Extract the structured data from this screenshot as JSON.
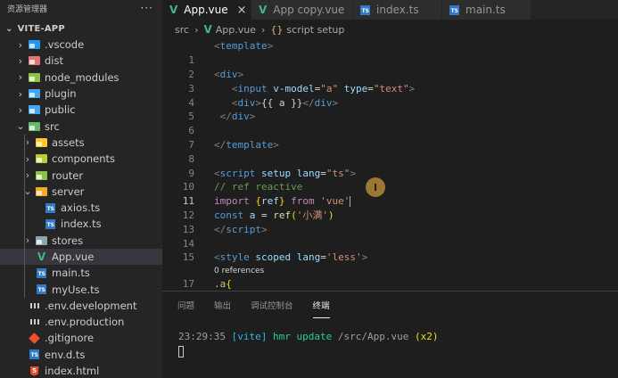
{
  "sidebar": {
    "title": "资源管理器",
    "more": "···",
    "root": "VITE-APP",
    "items": [
      {
        "label": ".vscode",
        "chev": "›",
        "icon": "folder",
        "color": "#2196f3",
        "depth": 0
      },
      {
        "label": "dist",
        "chev": "›",
        "icon": "folder",
        "color": "#e57373",
        "depth": 0
      },
      {
        "label": "node_modules",
        "chev": "›",
        "icon": "folder",
        "color": "#8bc34a",
        "depth": 0
      },
      {
        "label": "plugin",
        "chev": "›",
        "icon": "folder",
        "color": "#42a5f5",
        "depth": 0
      },
      {
        "label": "public",
        "chev": "›",
        "icon": "folder",
        "color": "#42a5f5",
        "depth": 0
      },
      {
        "label": "src",
        "chev": "⌄",
        "icon": "folder",
        "color": "#66bb6a",
        "depth": 0
      },
      {
        "label": "assets",
        "chev": "›",
        "icon": "folder",
        "color": "#ffca28",
        "depth": 1
      },
      {
        "label": "components",
        "chev": "›",
        "icon": "folder",
        "color": "#c0ca33",
        "depth": 1
      },
      {
        "label": "router",
        "chev": "›",
        "icon": "folder",
        "color": "#8bc34a",
        "depth": 1
      },
      {
        "label": "server",
        "chev": "⌄",
        "icon": "folder",
        "color": "#ffa726",
        "depth": 1
      },
      {
        "label": "axios.ts",
        "chev": "",
        "icon": "ts",
        "depth": 2
      },
      {
        "label": "index.ts",
        "chev": "",
        "icon": "ts",
        "depth": 2
      },
      {
        "label": "stores",
        "chev": "›",
        "icon": "folder",
        "color": "#90a4ae",
        "depth": 1
      },
      {
        "label": "App.vue",
        "chev": "",
        "icon": "vue",
        "depth": 1,
        "selected": true
      },
      {
        "label": "main.ts",
        "chev": "",
        "icon": "ts",
        "depth": 1
      },
      {
        "label": "myUse.ts",
        "chev": "",
        "icon": "ts",
        "depth": 1
      },
      {
        "label": ".env.development",
        "chev": "",
        "icon": "env",
        "depth": 0
      },
      {
        "label": ".env.production",
        "chev": "",
        "icon": "env",
        "depth": 0
      },
      {
        "label": ".gitignore",
        "chev": "",
        "icon": "git",
        "depth": 0
      },
      {
        "label": "env.d.ts",
        "chev": "",
        "icon": "ts",
        "depth": 0
      },
      {
        "label": "index.html",
        "chev": "",
        "icon": "html",
        "depth": 0
      }
    ]
  },
  "tabs": [
    {
      "label": "App.vue",
      "icon": "vue",
      "active": true,
      "close": "×"
    },
    {
      "label": "App copy.vue",
      "icon": "vue",
      "active": false
    },
    {
      "label": "index.ts",
      "icon": "ts",
      "active": false
    },
    {
      "label": "main.ts",
      "icon": "ts",
      "active": false
    }
  ],
  "breadcrumb": {
    "src": "src",
    "sep": "›",
    "file": "App.vue",
    "braces": "{}",
    "symbol": "script setup"
  },
  "code": [
    {
      "n": "",
      "kind": "code",
      "tokens": [
        [
          "<",
          "t-punc"
        ],
        [
          "template",
          "t-tag"
        ],
        [
          ">",
          "t-punc"
        ]
      ]
    },
    {
      "n": "1",
      "kind": "code",
      "tokens": []
    },
    {
      "n": "2",
      "kind": "code",
      "tokens": [
        [
          "<",
          "t-punc"
        ],
        [
          "div",
          "t-tag"
        ],
        [
          ">",
          "t-punc"
        ]
      ]
    },
    {
      "n": "3",
      "kind": "code",
      "tokens": [
        [
          "   ",
          "t-plain"
        ],
        [
          "<",
          "t-punc"
        ],
        [
          "input",
          "t-tag"
        ],
        [
          " ",
          "t-plain"
        ],
        [
          "v-model",
          "t-attr"
        ],
        [
          "=",
          "t-plain"
        ],
        [
          "\"a\"",
          "t-str"
        ],
        [
          " ",
          "t-plain"
        ],
        [
          "type",
          "t-attr"
        ],
        [
          "=",
          "t-plain"
        ],
        [
          "\"text\"",
          "t-str"
        ],
        [
          ">",
          "t-punc"
        ]
      ]
    },
    {
      "n": "4",
      "kind": "code",
      "tokens": [
        [
          "   ",
          "t-plain"
        ],
        [
          "<",
          "t-punc"
        ],
        [
          "div",
          "t-tag"
        ],
        [
          ">",
          "t-punc"
        ],
        [
          "{{ a }}",
          "t-plain"
        ],
        [
          "</",
          "t-punc"
        ],
        [
          "div",
          "t-tag"
        ],
        [
          ">",
          "t-punc"
        ]
      ]
    },
    {
      "n": "5",
      "kind": "code",
      "tokens": [
        [
          " ",
          "t-plain"
        ],
        [
          "</",
          "t-punc"
        ],
        [
          "div",
          "t-tag"
        ],
        [
          ">",
          "t-punc"
        ]
      ]
    },
    {
      "n": "6",
      "kind": "code",
      "tokens": []
    },
    {
      "n": "7",
      "kind": "code",
      "tokens": [
        [
          "</",
          "t-punc"
        ],
        [
          "template",
          "t-tag"
        ],
        [
          ">",
          "t-punc"
        ]
      ]
    },
    {
      "n": "8",
      "kind": "code",
      "tokens": []
    },
    {
      "n": "9",
      "kind": "code",
      "tokens": [
        [
          "<",
          "t-punc"
        ],
        [
          "script",
          "t-tag"
        ],
        [
          " ",
          "t-plain"
        ],
        [
          "setup",
          "t-attr"
        ],
        [
          " ",
          "t-plain"
        ],
        [
          "lang",
          "t-attr"
        ],
        [
          "=",
          "t-plain"
        ],
        [
          "\"ts\"",
          "t-str"
        ],
        [
          ">",
          "t-punc"
        ]
      ]
    },
    {
      "n": "10",
      "kind": "code",
      "tokens": [
        [
          "// ref reactive",
          "t-com"
        ]
      ]
    },
    {
      "n": "11",
      "kind": "code",
      "cur": true,
      "tokens": [
        [
          "import",
          "t-kw"
        ],
        [
          " ",
          "t-plain"
        ],
        [
          "{",
          "t-br"
        ],
        [
          "ref",
          "t-var"
        ],
        [
          "}",
          "t-br"
        ],
        [
          " ",
          "t-plain"
        ],
        [
          "from",
          "t-kw"
        ],
        [
          " ",
          "t-plain"
        ],
        [
          "'vue'",
          "t-str"
        ]
      ]
    },
    {
      "n": "12",
      "kind": "code",
      "tokens": [
        [
          "const",
          "t-key"
        ],
        [
          " ",
          "t-plain"
        ],
        [
          "a",
          "t-var"
        ],
        [
          " = ",
          "t-plain"
        ],
        [
          "ref",
          "t-fn"
        ],
        [
          "(",
          "t-br"
        ],
        [
          "'小满'",
          "t-str"
        ],
        [
          ")",
          "t-br"
        ]
      ]
    },
    {
      "n": "13",
      "kind": "code",
      "tokens": [
        [
          "</",
          "t-punc"
        ],
        [
          "script",
          "t-tag"
        ],
        [
          ">",
          "t-punc"
        ]
      ]
    },
    {
      "n": "14",
      "kind": "code",
      "tokens": []
    },
    {
      "n": "15",
      "kind": "code",
      "tokens": [
        [
          "<",
          "t-punc"
        ],
        [
          "style",
          "t-tag"
        ],
        [
          " ",
          "t-plain"
        ],
        [
          "scoped",
          "t-attr"
        ],
        [
          " ",
          "t-plain"
        ],
        [
          "lang",
          "t-attr"
        ],
        [
          "=",
          "t-plain"
        ],
        [
          "'less'",
          "t-str"
        ],
        [
          ">",
          "t-punc"
        ]
      ]
    },
    {
      "n": "16",
      "kind": "lens",
      "tokens": [
        [
          "0 references",
          "t-plain"
        ]
      ]
    },
    {
      "n": "17",
      "kind": "code",
      "tokens": [
        [
          ".a",
          "t-cls"
        ],
        [
          "{",
          "t-br"
        ]
      ]
    }
  ],
  "panel": {
    "tabs": [
      {
        "label": "问题"
      },
      {
        "label": "输出"
      },
      {
        "label": "调试控制台"
      },
      {
        "label": "终端",
        "active": true
      }
    ],
    "terminal": {
      "time": "23:29:35",
      "tag": "[vite]",
      "msg": "hmr update",
      "path": "/src/App.vue",
      "count": "(x2)"
    }
  },
  "pointer_glyph": "I",
  "colors": {
    "terminal_time": "#9e9e9e",
    "terminal_tag": "#29b8db",
    "terminal_msg": "#23d18b",
    "terminal_path": "#9e9e9e",
    "terminal_count": "#e5e510",
    "accent": "#41b883"
  }
}
